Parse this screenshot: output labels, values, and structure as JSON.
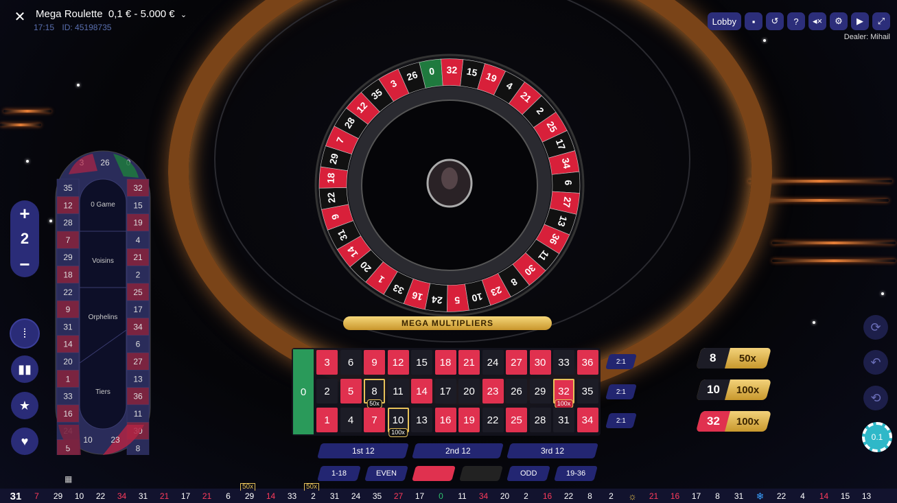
{
  "header": {
    "close_icon": "close-icon",
    "title": "Mega Roulette",
    "limits": "0,1 € - 5.000 €",
    "time": "17:15",
    "id": "ID: 45198735",
    "dealer": "Dealer: Mihail"
  },
  "toolbar": {
    "lobby_label": "Lobby",
    "icons": [
      "chat-icon",
      "history-icon",
      "help-icon",
      "mute-icon",
      "settings-icon",
      "video-icon",
      "fullscreen-icon"
    ]
  },
  "zoom": {
    "plus": "+",
    "value": "2",
    "minus": "−"
  },
  "racetrack": {
    "sections": [
      "0 Game",
      "Voisins",
      "Orphelins",
      "Tiers"
    ],
    "top": [
      "3",
      "26",
      "0"
    ],
    "left": [
      "35",
      "12",
      "28",
      "7",
      "29",
      "18",
      "22",
      "9",
      "31",
      "14",
      "20",
      "1",
      "33",
      "16",
      "24",
      "5"
    ],
    "right": [
      "32",
      "15",
      "19",
      "4",
      "21",
      "2",
      "25",
      "17",
      "34",
      "6",
      "27",
      "13",
      "36",
      "11",
      "30",
      "8"
    ],
    "bottom": [
      "10",
      "23"
    ]
  },
  "mega_title": "MEGA MULTIPLIERS",
  "board": {
    "zero": "0",
    "rows": [
      [
        "3",
        "6",
        "9",
        "12",
        "15",
        "18",
        "21",
        "24",
        "27",
        "30",
        "33",
        "36"
      ],
      [
        "2",
        "5",
        "8",
        "11",
        "14",
        "17",
        "20",
        "23",
        "26",
        "29",
        "32",
        "35"
      ],
      [
        "1",
        "4",
        "7",
        "10",
        "13",
        "16",
        "19",
        "22",
        "25",
        "28",
        "31",
        "34"
      ]
    ],
    "red": [
      "1",
      "3",
      "5",
      "7",
      "9",
      "12",
      "14",
      "16",
      "18",
      "19",
      "21",
      "23",
      "25",
      "27",
      "30",
      "32",
      "34",
      "36"
    ],
    "mega_cells": [
      {
        "number": "8",
        "multiplier": "50x"
      },
      {
        "number": "32",
        "multiplier": "100x"
      },
      {
        "number": "10",
        "multiplier": "100x"
      }
    ],
    "column_label": "2:1",
    "dozens": [
      "1st 12",
      "2nd 12",
      "3rd 12"
    ],
    "outside": [
      "1-18",
      "EVEN",
      "",
      "",
      "ODD",
      "19-36"
    ]
  },
  "multipliers": [
    {
      "number": "8",
      "value": "50x",
      "color": "#1c1c26"
    },
    {
      "number": "10",
      "value": "100x",
      "color": "#1c1c26"
    },
    {
      "number": "32",
      "value": "100x",
      "color": "#e0314f"
    }
  ],
  "chip_value": "0.1",
  "history": [
    {
      "v": "31",
      "c": "white"
    },
    {
      "v": "7",
      "c": "red"
    },
    {
      "v": "29",
      "c": "white"
    },
    {
      "v": "10",
      "c": "white"
    },
    {
      "v": "22",
      "c": "white"
    },
    {
      "v": "34",
      "c": "red"
    },
    {
      "v": "31",
      "c": "white"
    },
    {
      "v": "21",
      "c": "red"
    },
    {
      "v": "17",
      "c": "white"
    },
    {
      "v": "21",
      "c": "red"
    },
    {
      "v": "6",
      "c": "white"
    },
    {
      "v": "29",
      "c": "white",
      "m": "50x"
    },
    {
      "v": "14",
      "c": "red"
    },
    {
      "v": "33",
      "c": "white"
    },
    {
      "v": "2",
      "c": "white",
      "m": "50x"
    },
    {
      "v": "31",
      "c": "white"
    },
    {
      "v": "24",
      "c": "white"
    },
    {
      "v": "35",
      "c": "white"
    },
    {
      "v": "27",
      "c": "red"
    },
    {
      "v": "17",
      "c": "white"
    },
    {
      "v": "0",
      "c": "green"
    },
    {
      "v": "11",
      "c": "white"
    },
    {
      "v": "34",
      "c": "red"
    },
    {
      "v": "20",
      "c": "white"
    },
    {
      "v": "2",
      "c": "white"
    },
    {
      "v": "16",
      "c": "red"
    },
    {
      "v": "22",
      "c": "white"
    },
    {
      "v": "8",
      "c": "white"
    },
    {
      "v": "2",
      "c": "white"
    },
    {
      "v": "☼",
      "c": "icon-sun"
    },
    {
      "v": "21",
      "c": "red"
    },
    {
      "v": "16",
      "c": "red"
    },
    {
      "v": "17",
      "c": "white"
    },
    {
      "v": "8",
      "c": "white"
    },
    {
      "v": "31",
      "c": "white"
    },
    {
      "v": "❄",
      "c": "icon-snow"
    },
    {
      "v": "22",
      "c": "white"
    },
    {
      "v": "4",
      "c": "white"
    },
    {
      "v": "14",
      "c": "red"
    },
    {
      "v": "15",
      "c": "white"
    },
    {
      "v": "13",
      "c": "white"
    }
  ],
  "wheel_numbers": [
    "0",
    "32",
    "15",
    "19",
    "4",
    "21",
    "2",
    "25",
    "17",
    "34",
    "6",
    "27",
    "13",
    "36",
    "11",
    "30",
    "8",
    "23",
    "10",
    "5",
    "24",
    "16",
    "33",
    "1",
    "20",
    "14",
    "31",
    "9",
    "22",
    "18",
    "29",
    "7",
    "28",
    "12",
    "35",
    "3",
    "26"
  ]
}
